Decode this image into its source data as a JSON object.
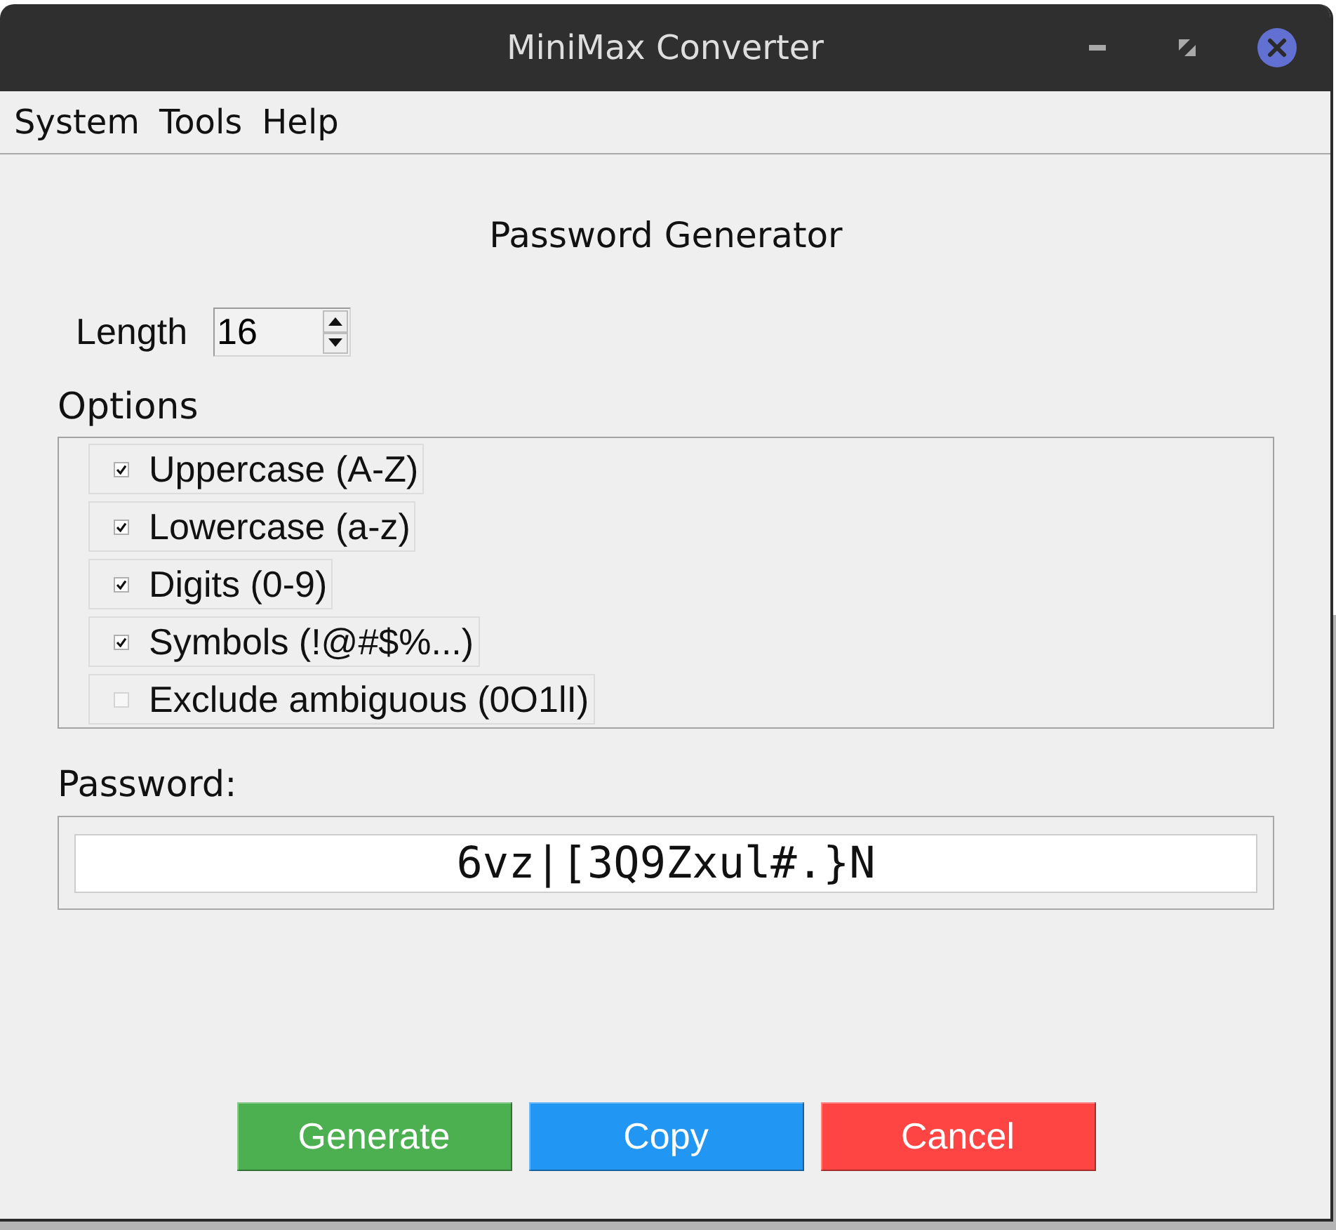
{
  "window": {
    "title": "MiniMax Converter"
  },
  "menu": [
    "System",
    "Tools",
    "Help"
  ],
  "heading": "Password Generator",
  "length": {
    "label": "Length",
    "value": "16"
  },
  "options": {
    "title": "Options",
    "items": [
      {
        "label": "Uppercase (A-Z)",
        "checked": true
      },
      {
        "label": "Lowercase (a-z)",
        "checked": true
      },
      {
        "label": "Digits (0-9)",
        "checked": true
      },
      {
        "label": "Symbols (!@#$%...)",
        "checked": true
      },
      {
        "label": "Exclude ambiguous (0O1lI)",
        "checked": false
      }
    ]
  },
  "password": {
    "label": "Password:",
    "value": "6vz|[3Q9Zxul#.}N"
  },
  "buttons": [
    {
      "label": "Generate",
      "color": "#4caf50"
    },
    {
      "label": "Copy",
      "color": "#2196f3"
    },
    {
      "label": "Cancel",
      "color": "#ff4444"
    }
  ]
}
